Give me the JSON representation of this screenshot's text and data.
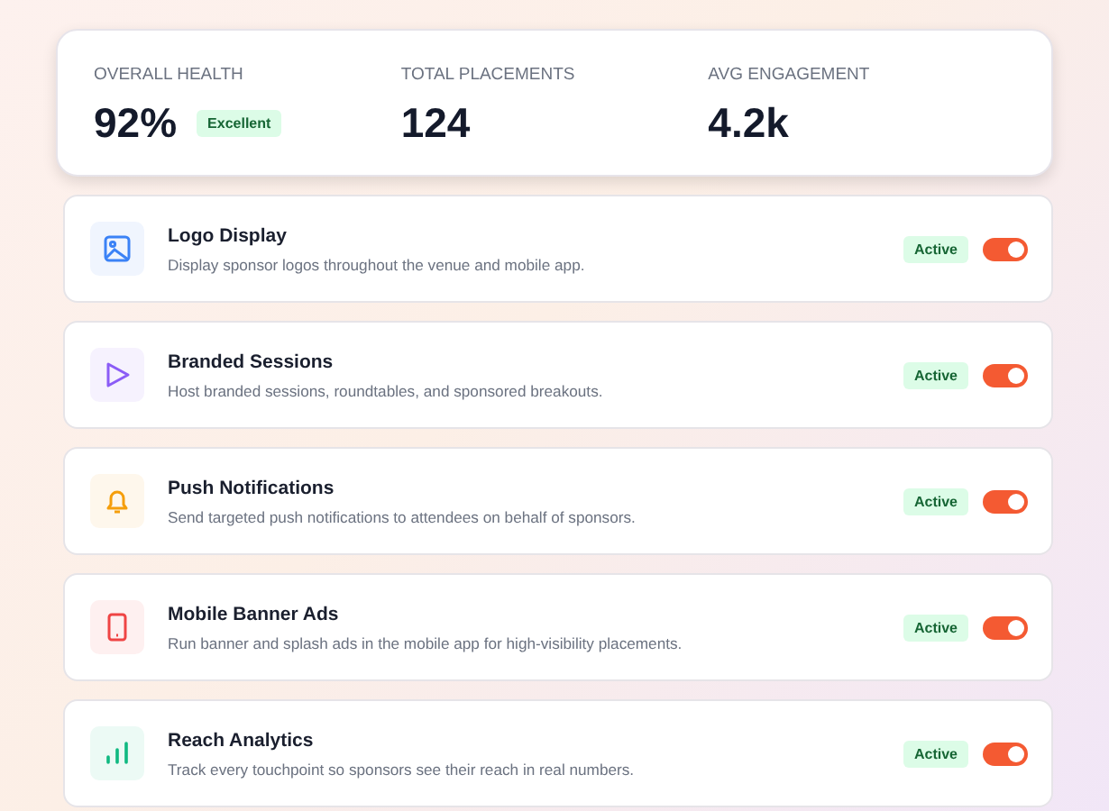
{
  "stats": [
    {
      "label": "OVERALL HEALTH",
      "value": "92%",
      "badge": "Excellent"
    },
    {
      "label": "TOTAL PLACEMENTS",
      "value": "124"
    },
    {
      "label": "AVG ENGAGEMENT",
      "value": "4.2k"
    }
  ],
  "features": [
    {
      "kind": "image",
      "color": "#3b82f6",
      "title": "Logo Display",
      "description": "Display sponsor logos throughout the venue and mobile app.",
      "status": "Active",
      "on": true
    },
    {
      "kind": "play",
      "color": "#8b5cf6",
      "title": "Branded Sessions",
      "description": "Host branded sessions, roundtables, and sponsored breakouts.",
      "status": "Active",
      "on": true
    },
    {
      "kind": "bell",
      "color": "#f59e0b",
      "title": "Push Notifications",
      "description": "Send targeted push notifications to attendees on behalf of sponsors.",
      "status": "Active",
      "on": true
    },
    {
      "kind": "phone",
      "color": "#ef4444",
      "title": "Mobile Banner Ads",
      "description": "Run banner and splash ads in the mobile app for high-visibility placements.",
      "status": "Active",
      "on": true
    },
    {
      "kind": "bars",
      "color": "#10b981",
      "title": "Reach Analytics",
      "description": "Track every touchpoint so sponsors see their reach in real numbers.",
      "status": "Active",
      "on": true
    }
  ]
}
